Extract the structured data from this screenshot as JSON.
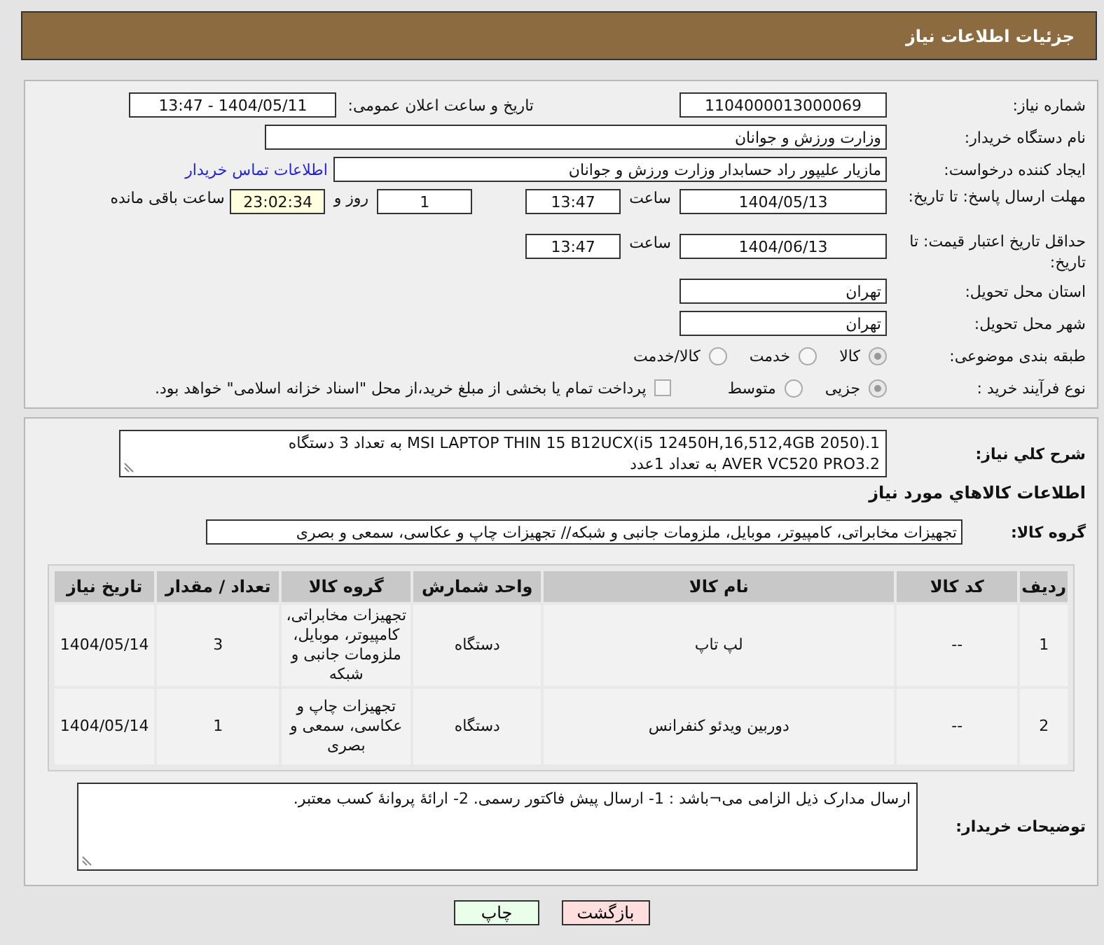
{
  "header": {
    "title": "جزئیات اطلاعات نیاز"
  },
  "need_number": {
    "label": "شماره نیاز:",
    "value": "1104000013000069"
  },
  "announce": {
    "label": "تاریخ و ساعت اعلان عمومی:",
    "value": "1404/05/11 - 13:47"
  },
  "buyer_org": {
    "label": "نام دستگاه خریدار:",
    "value": "وزارت ورزش و جوانان"
  },
  "requester": {
    "label": "ایجاد کننده درخواست:",
    "value": "مازیار  علیپور راد حسابدار وزارت ورزش و جوانان",
    "link": "اطلاعات تماس خریدار"
  },
  "reply_deadline": {
    "label": "مهلت ارسال پاسخ: تا تاریخ:",
    "date": "1404/05/13",
    "time_label": "ساعت",
    "time": "13:47",
    "days": "1",
    "days_label": "روز و",
    "remaining": "23:02:34",
    "remaining_label": "ساعت باقی مانده"
  },
  "price_validity": {
    "label": "حداقل تاریخ اعتبار قیمت: تا تاریخ:",
    "date": "1404/06/13",
    "time_label": "ساعت",
    "time": "13:47"
  },
  "province": {
    "label": "استان محل تحویل:",
    "value": "تهران"
  },
  "city": {
    "label": "شهر محل تحویل:",
    "value": "تهران"
  },
  "category": {
    "label": "طبقه بندی موضوعی:",
    "options": [
      {
        "label": "کالا",
        "selected": true
      },
      {
        "label": "خدمت",
        "selected": false
      },
      {
        "label": "کالا/خدمت",
        "selected": false
      }
    ]
  },
  "process": {
    "label": "نوع فرآیند خرید :",
    "options": [
      {
        "label": "جزیی",
        "selected": true
      },
      {
        "label": "متوسط",
        "selected": false
      }
    ],
    "payment": {
      "checked": false,
      "text": "پرداخت تمام یا بخشی از مبلغ خرید،از محل \"اسناد خزانه اسلامی\" خواهد بود."
    }
  },
  "description": {
    "label": "شرح کلي نياز:",
    "lines": [
      "1.MSI LAPTOP THIN 15 B12UCX(i5 12450H,16,512,4GB 2050)   به تعداد 3 دستگاه",
      "2.AVER VC520 PRO3        به تعداد 1عدد"
    ]
  },
  "goods_heading": "اطلاعات کالاهاي مورد نياز",
  "goods_group": {
    "label": "گروه کالا:",
    "value": "تجهیزات مخابراتی، کامپیوتر، موبایل، ملزومات جانبی و شبکه// تجهیزات چاپ و عکاسی، سمعی و بصری"
  },
  "table": {
    "columns": [
      "ردیف",
      "کد کالا",
      "نام کالا",
      "واحد شمارش",
      "گروه کالا",
      "تعداد / مقدار",
      "تاریخ نیاز"
    ],
    "rows": [
      [
        "1",
        "--",
        "لپ تاپ",
        "دستگاه",
        "تجهیزات مخابراتی، کامپیوتر، موبایل، ملزومات جانبی و شبکه",
        "3",
        "1404/05/14"
      ],
      [
        "2",
        "--",
        "دوربین ویدئو کنفرانس",
        "دستگاه",
        "تجهیزات چاپ و عکاسی، سمعی و بصری",
        "1",
        "1404/05/14"
      ]
    ]
  },
  "buyer_notes": {
    "label": "توضیحات خریدار:",
    "value": "ارسال مدارک ذیل الزامی می¬باشد : 1- ارسال پیش فاکتور رسمی. 2- ارائۀ پروانۀ کسب معتبر."
  },
  "buttons": [
    {
      "label": "بازگشت",
      "kind": "back"
    },
    {
      "label": "چاپ",
      "kind": "print"
    }
  ]
}
